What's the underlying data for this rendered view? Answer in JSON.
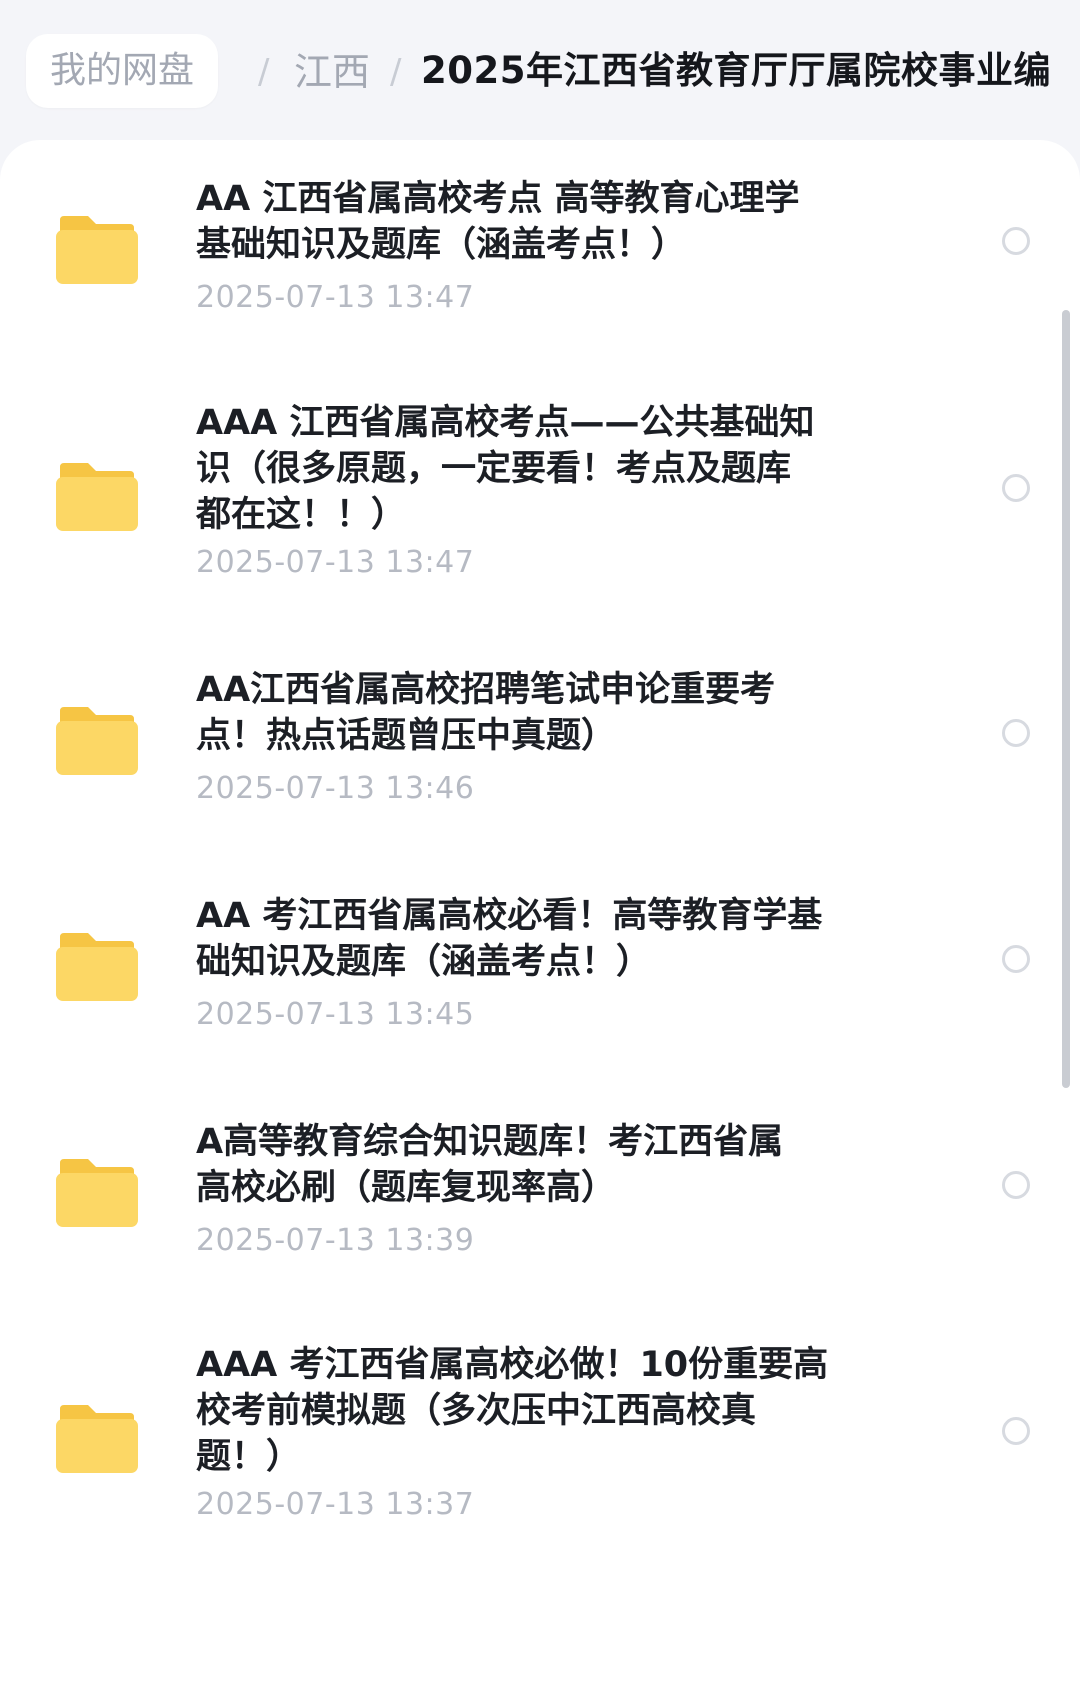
{
  "breadcrumb": {
    "root": "我的网盘",
    "separator": "/",
    "parent": "江西",
    "current": "2025年江西省教育厅厅属院校事业编"
  },
  "files": [
    {
      "name_lines": [
        "AA 江西省属高校考点 高等教育心理学",
        "基础知识及题库（涵盖考点！）"
      ],
      "date": "2025-07-13 13:47"
    },
    {
      "name_lines": [
        "AAA 江西省属高校考点——公共基础知",
        "识（很多原题，一定要看！考点及题库",
        "都在这！！）"
      ],
      "date": "2025-07-13 13:47"
    },
    {
      "name_lines": [
        "AA江西省属高校招聘笔试申论重要考",
        "点！热点话题曾压中真题）"
      ],
      "date": "2025-07-13 13:46"
    },
    {
      "name_lines": [
        "AA 考江西省属高校必看！高等教育学基",
        "础知识及题库（涵盖考点！）"
      ],
      "date": "2025-07-13 13:45"
    },
    {
      "name_lines": [
        "A高等教育综合知识题库！考江西省属",
        "高校必刷（题库复现率高）"
      ],
      "date": "2025-07-13 13:39"
    },
    {
      "name_lines": [
        "AAA 考江西省属高校必做！10份重要高",
        "校考前模拟题（多次压中江西高校真",
        "题！）"
      ],
      "date": "2025-07-13 13:37"
    }
  ],
  "colors": {
    "folder_body": "#fcd765",
    "folder_tab": "#f6c544",
    "title_text": "#1c1f25",
    "date_text": "#b6bac3",
    "muted_text": "#a3a8b3"
  }
}
